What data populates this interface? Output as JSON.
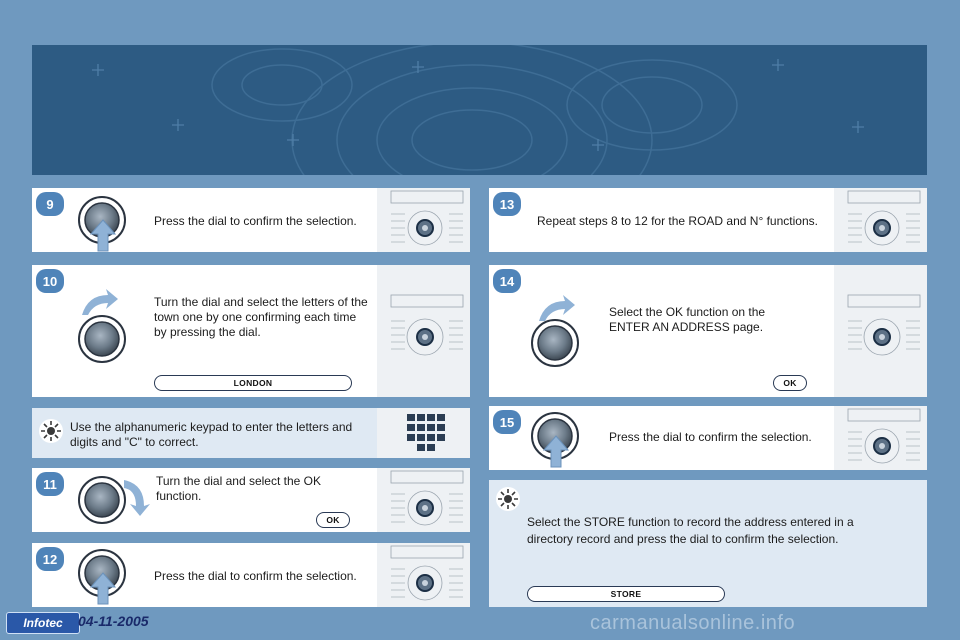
{
  "steps": {
    "s9": {
      "num": "9",
      "text": "Press the dial to confirm the selection."
    },
    "s10": {
      "num": "10",
      "text": "Turn the dial and select the letters of the town one by one confirming each time by pressing the dial.",
      "pill": "LONDON"
    },
    "tip1": {
      "text": "Use the alphanumeric keypad to enter the letters and digits and \"C\" to correct."
    },
    "s11": {
      "num": "11",
      "text": "Turn the dial and select the OK function.",
      "pill": "OK"
    },
    "s12": {
      "num": "12",
      "text": "Press the dial to confirm the selection."
    },
    "s13": {
      "num": "13",
      "text": "Repeat steps 8 to 12 for the ROAD and N° functions."
    },
    "s14": {
      "num": "14",
      "text": "Select the OK function on the ENTER AN ADDRESS page.",
      "pill": "OK"
    },
    "s15": {
      "num": "15",
      "text": "Press the dial to confirm the selection."
    },
    "tip2": {
      "text": "Select the STORE function to record the address entered in a directory record and press the dial to confirm the selection.",
      "pill": "STORE"
    }
  },
  "footer": {
    "logo": "Infotec",
    "date": "04-11-2005",
    "watermark": "carmanualsonline.info"
  },
  "icons": {
    "dial": "control-dial-icon",
    "press": "press-arrow-icon",
    "turn": "turn-arrow-icon",
    "tip": "lightbulb-sun-icon",
    "panel": "radio-panel-icon"
  },
  "colors": {
    "background": "#6f99bf",
    "banner": "#2d5b83",
    "badge": "#4f84b9",
    "tip_card": "#dfe9f3"
  }
}
